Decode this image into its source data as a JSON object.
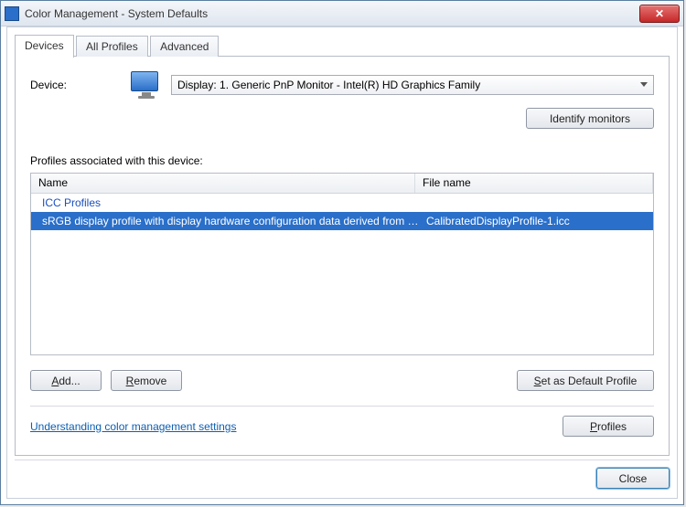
{
  "window": {
    "title": "Color Management - System Defaults"
  },
  "tabs": {
    "devices": "Devices",
    "allProfiles": "All Profiles",
    "advanced": "Advanced"
  },
  "deviceRow": {
    "label": "Device:",
    "selected": "Display: 1. Generic PnP Monitor - Intel(R) HD Graphics Family"
  },
  "buttons": {
    "identify": "Identify monitors",
    "add": "Add...",
    "remove": "Remove",
    "setDefault": "Set as Default Profile",
    "profiles": "Profiles",
    "close": "Close"
  },
  "profilesLabel": "Profiles associated with this device:",
  "columns": {
    "name": "Name",
    "file": "File name"
  },
  "group": "ICC Profiles",
  "row": {
    "name": "sRGB display profile with display hardware configuration data derived from cali…",
    "file": "CalibratedDisplayProfile-1.icc"
  },
  "link": "Understanding color management settings"
}
